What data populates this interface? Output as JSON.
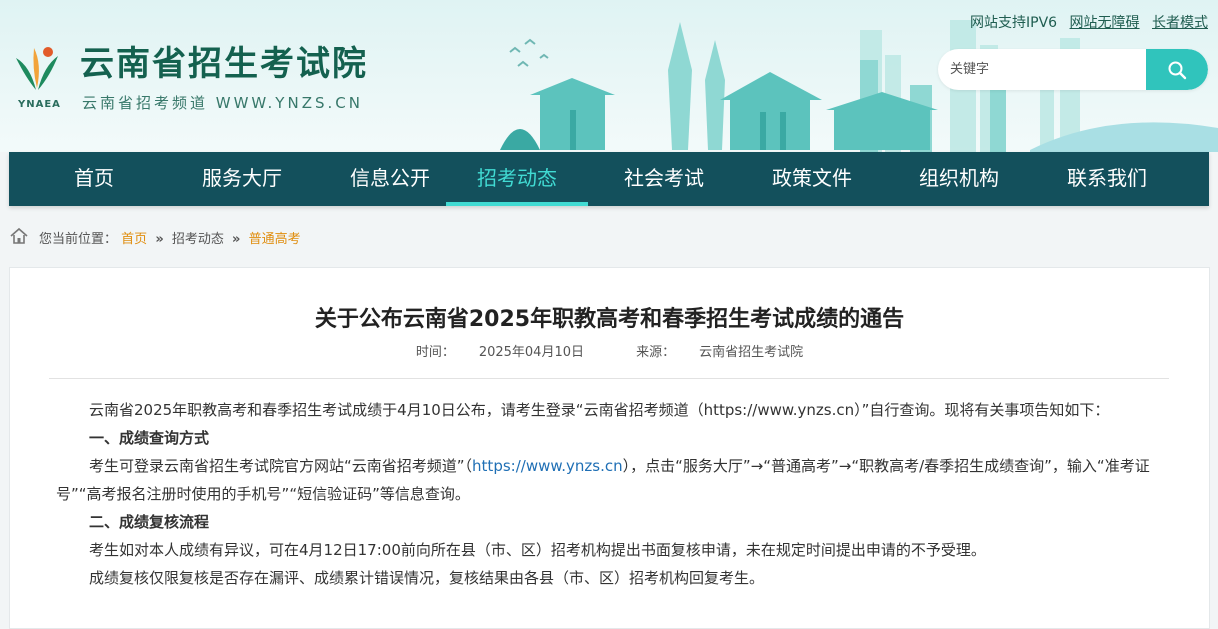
{
  "header": {
    "site_title": "云南省招生考试院",
    "site_subtitle": "云南省招考频道 WWW.YNZS.CN",
    "logo_abbr": "YNAEA",
    "top_links": [
      "网站支持IPV6",
      "网站无障碍",
      "长者模式"
    ],
    "search_placeholder": "关键字"
  },
  "nav": {
    "items": [
      "首页",
      "服务大厅",
      "信息公开",
      "招考动态",
      "社会考试",
      "政策文件",
      "组织机构",
      "联系我们"
    ],
    "active": "招考动态"
  },
  "breadcrumb": {
    "label": "您当前位置：",
    "home": "首页",
    "section": "招考动态",
    "current": "普通高考",
    "sep": "»"
  },
  "article": {
    "title": "关于公布云南省2025年职教高考和春季招生考试成绩的通告",
    "time_label": "时间：",
    "time": "2025年04月10日",
    "source_label": "来源：",
    "source": "云南省招生考试院",
    "p1": "云南省2025年职教高考和春季招生考试成绩于4月10日公布，请考生登录“云南省招考频道（https://www.ynzs.cn）”自行查询。现将有关事项告知如下：",
    "h1": "一、成绩查询方式",
    "p2_a": "考生可登录云南省招生考试院官方网站“云南省招考频道”（",
    "p2_url": "https://www.ynzs.cn",
    "p2_b": "），点击“服务大厅”→“普通高考”→“职教高考/春季招生成绩查询”，输入“准考证号”“高考报名注册时使用的手机号”“短信验证码”等信息查询。",
    "h2": "二、成绩复核流程",
    "p3": "考生如对本人成绩有异议，可在4月12日17:00前向所在县（市、区）招考机构提出书面复核申请，未在规定时间提出申请的不予受理。",
    "p4": "成绩复核仅限复核是否存在漏评、成绩累计错误情况，复核结果由各县（市、区）招考机构回复考生。"
  },
  "colors": {
    "nav_bg": "#13505c",
    "accent": "#41dbd3",
    "search_btn": "#30c4bc",
    "crumb_link": "#e08e10",
    "title_green": "#14614f"
  }
}
